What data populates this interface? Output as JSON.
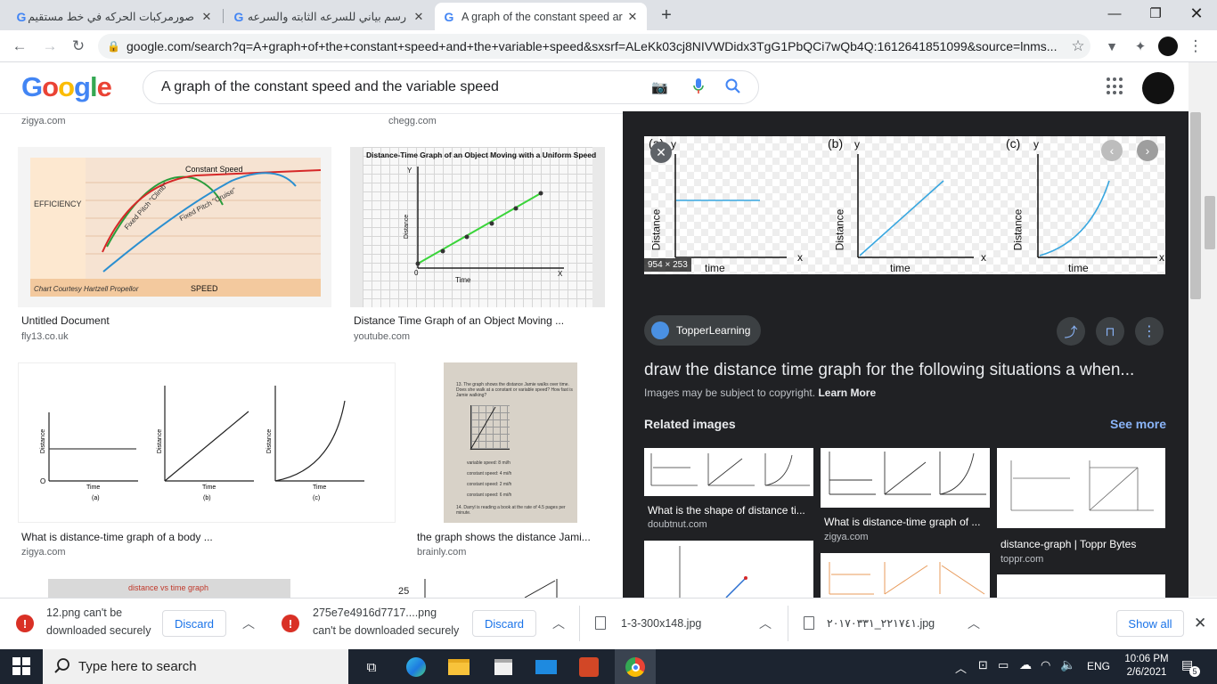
{
  "tabs": [
    {
      "title": "صورمركبات الحركه في خط مستقيم"
    },
    {
      "title": "رسم بياني للسرعه الثابته والسرعه الـ"
    },
    {
      "title": "A graph of the constant speed ar"
    }
  ],
  "address": {
    "url": "google.com/search?q=A+graph+of+the+constant+speed+and+the+variable+speed&sxsrf=ALeKk03cj8NIVWDidx3TgG1PbQCi7wQb4Q:1612641851099&source=lnms..."
  },
  "search": {
    "query": "A graph of the constant speed and the variable speed",
    "logo": "Google"
  },
  "results": [
    {
      "source_top": "zigya.com"
    },
    {
      "source_top": "chegg.com"
    },
    {
      "caption": "Untitled Document",
      "source": "fly13.co.uk",
      "img_text": [
        "EFFICIENCY",
        "Constant Speed",
        "Fixed Pitch \"Climb\"",
        "Fixed Pitch \"Cruise\"",
        "Chart Courtesy Hartzell Propellor",
        "SPEED"
      ]
    },
    {
      "caption": "Distance Time Graph of an Object Moving ...",
      "source": "youtube.com",
      "img_text": [
        "Distance-Time Graph of an Object Moving with a Uniform Speed",
        "Distance",
        "Time",
        "Y",
        "X",
        "0"
      ]
    },
    {
      "caption": "What is distance-time graph of a body ...",
      "source": "zigya.com",
      "img_text": [
        "Distance",
        "Time",
        "(a)",
        "(b)",
        "(c)",
        "O"
      ]
    },
    {
      "caption": "the graph shows the distance Jami...",
      "source": "brainly.com",
      "img_text": [
        "13. The graph shows the distance Jamie walks over time. Does she walk at a constant or variable speed? How fast is Jamie walking?",
        "variable speed: 8 mi/h",
        "constant speed: 4 mi/h",
        "constant speed: 2 mi/h",
        "constant speed: 6 mi/h",
        "14. Darryl is reading a book at the rate of 4.5 pages per minute."
      ]
    },
    {
      "img_text": "distance vs time graph"
    },
    {
      "img_text": "25"
    }
  ],
  "panel": {
    "main_labels": [
      "(a)",
      "(b)",
      "(c)",
      "Distance",
      "time",
      "y",
      "x"
    ],
    "size_badge": "954 × 253",
    "publisher": "TopperLearning",
    "title": "draw the distance time graph for the following situations a when...",
    "copyright": "Images may be subject to copyright.",
    "learn_more": "Learn More",
    "related_heading": "Related images",
    "see_more": "See more",
    "related": [
      {
        "caption": "What is the shape of distance ti...",
        "source": "doubtnut.com"
      },
      {
        "caption": "What is distance-time graph of ...",
        "source": "zigya.com"
      },
      {
        "caption": "distance-graph | Toppr Bytes",
        "source": "toppr.com"
      }
    ]
  },
  "downloads": [
    {
      "line1": "12.png can't be",
      "line2": "downloaded securely",
      "button": "Discard"
    },
    {
      "line1": "275e7e4916d7717....png",
      "line2": "can't be downloaded securely",
      "button": "Discard"
    },
    {
      "name": "1-3-300x148.jpg"
    },
    {
      "name": "٢٢١٧٤١_٢٠١٧٠٣٣١.jpg"
    }
  ],
  "downloads_show_all": "Show all",
  "taskbar": {
    "search_placeholder": "Type here to search",
    "lang": "ENG",
    "time": "10:06 PM",
    "date": "2/6/2021",
    "notif": "5"
  }
}
